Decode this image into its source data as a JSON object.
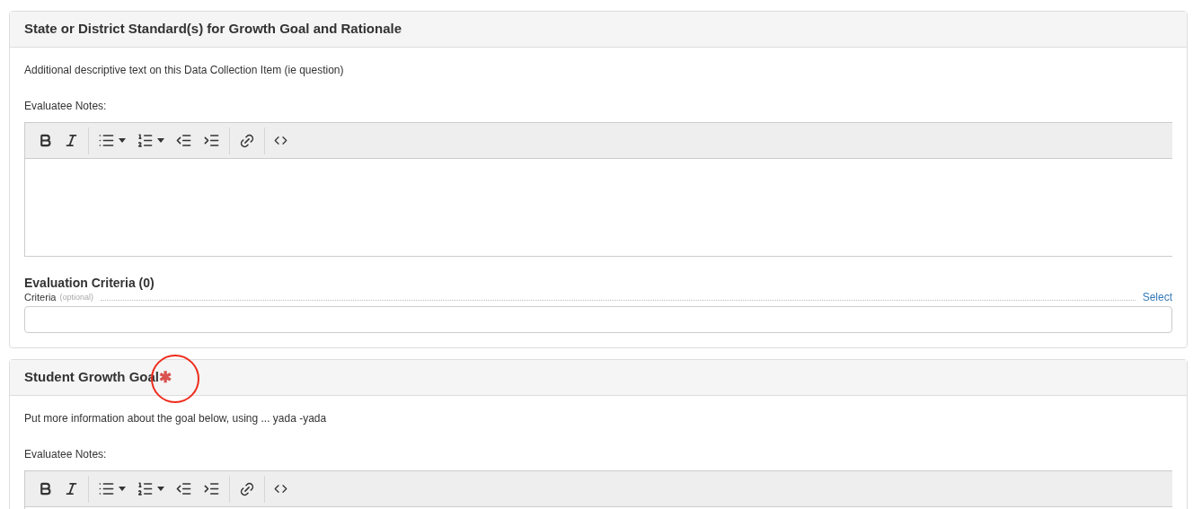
{
  "sections": [
    {
      "title": "State or District Standard(s) for Growth Goal and Rationale",
      "annotated": false,
      "description": "Additional descriptive text on this Data Collection Item (ie question)",
      "notes_label": "Evaluatee Notes:",
      "criteria": {
        "heading": "Evaluation Criteria (0)",
        "label": "Criteria",
        "hint": "(optional)",
        "action": "Select"
      }
    },
    {
      "title": "Student Growth Goal",
      "required_mark": "✱",
      "annotated": true,
      "description": "Put more information about the goal below, using ... yada -yada",
      "notes_label": "Evaluatee Notes:"
    }
  ]
}
